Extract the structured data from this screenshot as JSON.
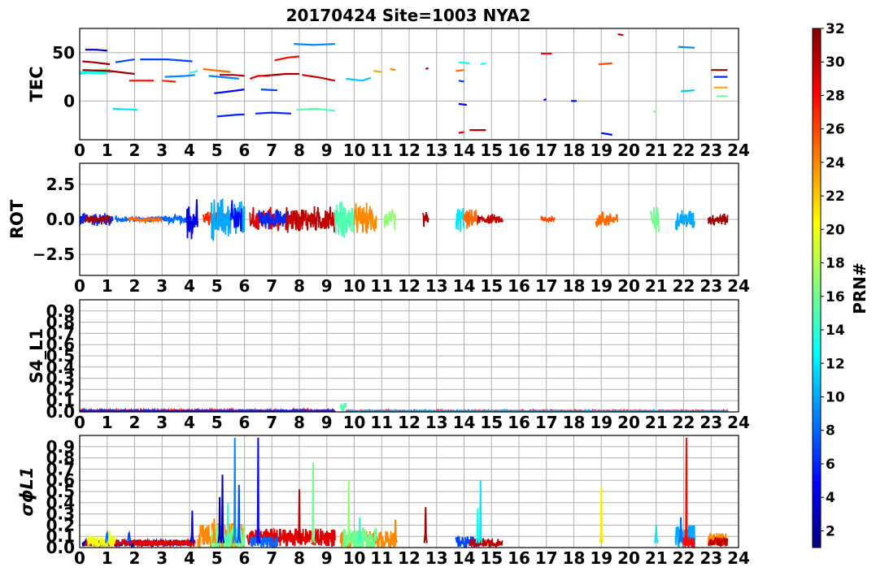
{
  "title": "20170424 Site=1003 NYA2",
  "colorbar": {
    "label": "PRN#",
    "ticks": [
      2,
      4,
      6,
      8,
      10,
      12,
      14,
      16,
      18,
      20,
      22,
      24,
      26,
      28,
      30,
      32
    ],
    "range": [
      1,
      32
    ],
    "colormap": "jet"
  },
  "x_ticks": [
    "0",
    "1",
    "2",
    "3",
    "4",
    "5",
    "6",
    "7",
    "8",
    "9",
    "10",
    "11",
    "12",
    "13",
    "14",
    "15",
    "16",
    "17",
    "18",
    "19",
    "20",
    "21",
    "22",
    "23",
    "24"
  ],
  "chart_data": [
    {
      "type": "line",
      "ylabel": "TEC",
      "xlim": [
        0,
        24
      ],
      "ylim": [
        -40,
        75
      ],
      "yticks": [
        {
          "v": 50,
          "t": "50"
        },
        {
          "v": 0,
          "t": "0"
        }
      ],
      "grid": true,
      "series": [
        {
          "prn": 3,
          "x": [
            0.2,
            0.6,
            1.0
          ],
          "y": [
            53,
            53,
            52
          ]
        },
        {
          "prn": 31,
          "x": [
            0.1,
            0.5,
            1.1
          ],
          "y": [
            41,
            40,
            38
          ]
        },
        {
          "prn": 17,
          "x": [
            0.1,
            0.6,
            1.0
          ],
          "y": [
            29,
            32,
            33
          ]
        },
        {
          "prn": 24,
          "x": [
            0.0,
            0.4,
            1.1
          ],
          "y": [
            28,
            30,
            32
          ]
        },
        {
          "prn": 13,
          "x": [
            0.0,
            0.5
          ],
          "y": [
            30,
            31
          ]
        },
        {
          "prn": 14,
          "x": [
            0.0,
            1.0
          ],
          "y": [
            29,
            28
          ]
        },
        {
          "prn": 13,
          "x": [
            0.0,
            1.2
          ],
          "y": [
            29,
            30
          ]
        },
        {
          "prn": 12,
          "x": [
            1.2,
            2.1
          ],
          "y": [
            -8,
            -9
          ]
        },
        {
          "prn": 7,
          "x": [
            1.3,
            2.0
          ],
          "y": [
            40,
            43
          ]
        },
        {
          "prn": 7,
          "x": [
            2.2,
            3.2,
            4.1
          ],
          "y": [
            43,
            43,
            41
          ]
        },
        {
          "prn": 28,
          "x": [
            1.8,
            2.7
          ],
          "y": [
            21,
            21
          ]
        },
        {
          "prn": 27,
          "x": [
            3.0,
            3.5
          ],
          "y": [
            21,
            20
          ]
        },
        {
          "prn": 31,
          "x": [
            0.1,
            1.1,
            2.0
          ],
          "y": [
            32,
            31,
            28
          ]
        },
        {
          "prn": 9,
          "x": [
            3.1,
            3.9,
            4.2
          ],
          "y": [
            25,
            26,
            27
          ]
        },
        {
          "prn": 14,
          "x": [
            4.0,
            4.3
          ],
          "y": [
            29,
            31
          ]
        },
        {
          "prn": 25,
          "x": [
            4.5,
            5.5
          ],
          "y": [
            33,
            30
          ]
        },
        {
          "prn": 5,
          "x": [
            4.9,
            5.5,
            6.0
          ],
          "y": [
            8,
            10,
            12
          ]
        },
        {
          "prn": 6,
          "x": [
            5.0,
            5.8,
            6.0
          ],
          "y": [
            -16,
            -14,
            -14
          ]
        },
        {
          "prn": 9,
          "x": [
            4.7,
            5.8
          ],
          "y": [
            26,
            23
          ]
        },
        {
          "prn": 30,
          "x": [
            5.1,
            5.6,
            6.0
          ],
          "y": [
            27,
            27,
            26
          ]
        },
        {
          "prn": 29,
          "x": [
            6.2,
            6.5,
            6.9
          ],
          "y": [
            23,
            26,
            26
          ]
        },
        {
          "prn": 7,
          "x": [
            6.6,
            7.2
          ],
          "y": [
            12,
            11
          ]
        },
        {
          "prn": 6,
          "x": [
            6.4,
            7.0,
            7.7
          ],
          "y": [
            -13,
            -12,
            -13
          ]
        },
        {
          "prn": 31,
          "x": [
            6.7,
            7.5,
            8.0
          ],
          "y": [
            26,
            28,
            28
          ]
        },
        {
          "prn": 28,
          "x": [
            7.1,
            7.6,
            8.0
          ],
          "y": [
            42,
            45,
            46
          ]
        },
        {
          "prn": 9,
          "x": [
            7.8,
            8.5,
            9.3
          ],
          "y": [
            59,
            58,
            59
          ]
        },
        {
          "prn": 15,
          "x": [
            7.9,
            8.6,
            9.3
          ],
          "y": [
            -9,
            -8,
            -10
          ]
        },
        {
          "prn": 30,
          "x": [
            8.1,
            8.8,
            9.3
          ],
          "y": [
            27,
            24,
            21
          ]
        },
        {
          "prn": 11,
          "x": [
            9.7,
            10.3,
            10.6
          ],
          "y": [
            23,
            21,
            24
          ]
        },
        {
          "prn": 23,
          "x": [
            10.7,
            11.0
          ],
          "y": [
            31,
            30
          ]
        },
        {
          "prn": 24,
          "x": [
            11.3,
            11.5
          ],
          "y": [
            33,
            32
          ]
        },
        {
          "prn": 31,
          "x": [
            12.6,
            12.7
          ],
          "y": [
            33,
            34
          ]
        },
        {
          "prn": 13,
          "x": [
            13.8,
            14.2
          ],
          "y": [
            40,
            39
          ]
        },
        {
          "prn": 13,
          "x": [
            14.6,
            14.8
          ],
          "y": [
            38,
            39
          ]
        },
        {
          "prn": 25,
          "x": [
            13.7,
            14.0
          ],
          "y": [
            31,
            32
          ]
        },
        {
          "prn": 7,
          "x": [
            13.8,
            14.0
          ],
          "y": [
            21,
            20
          ]
        },
        {
          "prn": 5,
          "x": [
            13.8,
            14.1
          ],
          "y": [
            -3,
            -4
          ]
        },
        {
          "prn": 29,
          "x": [
            13.8,
            14.0
          ],
          "y": [
            -33,
            -32
          ]
        },
        {
          "prn": 30,
          "x": [
            14.2,
            14.8
          ],
          "y": [
            -30,
            -30
          ]
        },
        {
          "prn": 28,
          "x": [
            16.8,
            17.2
          ],
          "y": [
            49,
            49
          ]
        },
        {
          "prn": 5,
          "x": [
            16.9,
            17.0
          ],
          "y": [
            1,
            2
          ]
        },
        {
          "prn": 5,
          "x": [
            17.9,
            18.1
          ],
          "y": [
            0,
            0
          ]
        },
        {
          "prn": 26,
          "x": [
            18.9,
            19.4
          ],
          "y": [
            38,
            39
          ]
        },
        {
          "prn": 5,
          "x": [
            19.0,
            19.4
          ],
          "y": [
            -33,
            -35
          ]
        },
        {
          "prn": 30,
          "x": [
            19.6,
            19.8
          ],
          "y": [
            69,
            68
          ]
        },
        {
          "prn": 16,
          "x": [
            20.9,
            21.0
          ],
          "y": [
            -10,
            -12
          ]
        },
        {
          "prn": 9,
          "x": [
            21.8,
            22.4
          ],
          "y": [
            56,
            55
          ]
        },
        {
          "prn": 11,
          "x": [
            21.9,
            22.4
          ],
          "y": [
            10,
            11
          ]
        },
        {
          "prn": 23,
          "x": [
            23.1,
            23.6
          ],
          "y": [
            14,
            14
          ]
        },
        {
          "prn": 31,
          "x": [
            23.0,
            23.6
          ],
          "y": [
            32,
            32
          ]
        },
        {
          "prn": 6,
          "x": [
            23.1,
            23.6
          ],
          "y": [
            25,
            25
          ]
        },
        {
          "prn": 16,
          "x": [
            23.2,
            23.6
          ],
          "y": [
            5,
            5
          ]
        }
      ]
    },
    {
      "type": "line",
      "ylabel": "ROT",
      "xlim": [
        0,
        24
      ],
      "ylim": [
        -4,
        4
      ],
      "yticks": [
        {
          "v": 2.5,
          "t": "2.5"
        },
        {
          "v": 0,
          "t": "0.0"
        },
        {
          "v": -2.5,
          "t": "−2.5"
        }
      ],
      "grid": true,
      "noise": [
        {
          "prn": 6,
          "x0": 0.0,
          "x1": 1.2,
          "amp": 0.6
        },
        {
          "prn": 31,
          "x0": 0.2,
          "x1": 1.1,
          "amp": 0.4
        },
        {
          "prn": 8,
          "x0": 1.3,
          "x1": 3.2,
          "amp": 0.25
        },
        {
          "prn": 25,
          "x0": 1.8,
          "x1": 3.0,
          "amp": 0.2
        },
        {
          "prn": 8,
          "x0": 3.1,
          "x1": 4.2,
          "amp": 0.35
        },
        {
          "prn": 4,
          "x0": 3.9,
          "x1": 4.3,
          "amp": 1.6
        },
        {
          "prn": 27,
          "x0": 4.5,
          "x1": 5.5,
          "amp": 0.7
        },
        {
          "prn": 10,
          "x0": 4.8,
          "x1": 6.0,
          "amp": 1.8
        },
        {
          "prn": 5,
          "x0": 5.5,
          "x1": 5.9,
          "amp": 1.6
        },
        {
          "prn": 29,
          "x0": 6.2,
          "x1": 7.3,
          "amp": 1.0
        },
        {
          "prn": 6,
          "x0": 6.5,
          "x1": 7.6,
          "amp": 0.8
        },
        {
          "prn": 30,
          "x0": 7.5,
          "x1": 9.3,
          "amp": 1.1
        },
        {
          "prn": 15,
          "x0": 9.3,
          "x1": 10.0,
          "amp": 1.6
        },
        {
          "prn": 24,
          "x0": 10.0,
          "x1": 10.8,
          "amp": 1.3
        },
        {
          "prn": 17,
          "x0": 11.1,
          "x1": 11.5,
          "amp": 0.9
        },
        {
          "prn": 31,
          "x0": 12.5,
          "x1": 12.7,
          "amp": 0.8
        },
        {
          "prn": 12,
          "x0": 13.7,
          "x1": 14.0,
          "amp": 1.1
        },
        {
          "prn": 25,
          "x0": 14.0,
          "x1": 14.5,
          "amp": 0.8
        },
        {
          "prn": 30,
          "x0": 14.5,
          "x1": 15.4,
          "amp": 0.4
        },
        {
          "prn": 26,
          "x0": 16.8,
          "x1": 17.3,
          "amp": 0.3
        },
        {
          "prn": 25,
          "x0": 18.8,
          "x1": 19.6,
          "amp": 0.7
        },
        {
          "prn": 16,
          "x0": 20.8,
          "x1": 21.1,
          "amp": 1.1
        },
        {
          "prn": 10,
          "x0": 21.7,
          "x1": 22.4,
          "amp": 0.9
        },
        {
          "prn": 31,
          "x0": 22.9,
          "x1": 23.6,
          "amp": 0.5
        }
      ]
    },
    {
      "type": "line",
      "ylabel": "S4_L1",
      "xlim": [
        0,
        24
      ],
      "ylim": [
        0,
        1
      ],
      "yticks": [
        {
          "v": 0.9,
          "t": "0.9"
        },
        {
          "v": 0.8,
          "t": "0.8"
        },
        {
          "v": 0.7,
          "t": "0.7"
        },
        {
          "v": 0.6,
          "t": "0.6"
        },
        {
          "v": 0.5,
          "t": "0.5"
        },
        {
          "v": 0.4,
          "t": "0.4"
        },
        {
          "v": 0.3,
          "t": "0.3"
        },
        {
          "v": 0.2,
          "t": "0.2"
        },
        {
          "v": 0.1,
          "t": "0.1"
        },
        {
          "v": 0.0,
          "t": "0.0"
        }
      ],
      "grid": true,
      "noise": [
        {
          "prn": 28,
          "x0": 0.0,
          "x1": 9.3,
          "amp": 0.008,
          "base": 0.01
        },
        {
          "prn": 6,
          "x0": 0.0,
          "x1": 9.3,
          "amp": 0.006,
          "base": 0.008
        },
        {
          "prn": 15,
          "x0": 9.5,
          "x1": 9.7,
          "amp": 0.04,
          "base": 0.04
        },
        {
          "prn": 28,
          "x0": 9.7,
          "x1": 23.6,
          "amp": 0.005,
          "base": 0.008
        },
        {
          "prn": 10,
          "x0": 9.7,
          "x1": 23.6,
          "amp": 0.005,
          "base": 0.006
        }
      ]
    },
    {
      "type": "line",
      "ylabel": "σϕL1",
      "xlim": [
        0,
        24
      ],
      "ylim": [
        0,
        1
      ],
      "yticks": [
        {
          "v": 0.9,
          "t": "0.9"
        },
        {
          "v": 0.8,
          "t": "0.8"
        },
        {
          "v": 0.7,
          "t": "0.7"
        },
        {
          "v": 0.6,
          "t": "0.6"
        },
        {
          "v": 0.5,
          "t": "0.5"
        },
        {
          "v": 0.4,
          "t": "0.4"
        },
        {
          "v": 0.3,
          "t": "0.3"
        },
        {
          "v": 0.2,
          "t": "0.2"
        },
        {
          "v": 0.1,
          "t": "0.1"
        },
        {
          "v": 0.0,
          "t": "0.0"
        }
      ],
      "grid": true,
      "noise": [
        {
          "prn": 2,
          "x0": 0.1,
          "x1": 4.2,
          "amp": 0.03,
          "base": 0.04
        },
        {
          "prn": 29,
          "x0": 0.2,
          "x1": 4.2,
          "amp": 0.03,
          "base": 0.04
        },
        {
          "prn": 20,
          "x0": 0.3,
          "x1": 1.3,
          "amp": 0.06,
          "base": 0.05
        },
        {
          "prn": 24,
          "x0": 4.3,
          "x1": 6.0,
          "amp": 0.12,
          "base": 0.1
        },
        {
          "prn": 16,
          "x0": 4.8,
          "x1": 6.0,
          "amp": 0.12,
          "base": 0.09
        },
        {
          "prn": 29,
          "x0": 6.1,
          "x1": 9.3,
          "amp": 0.08,
          "base": 0.09
        },
        {
          "prn": 8,
          "x0": 6.2,
          "x1": 7.2,
          "amp": 0.05,
          "base": 0.05
        },
        {
          "prn": 24,
          "x0": 9.5,
          "x1": 11.5,
          "amp": 0.08,
          "base": 0.07
        },
        {
          "prn": 16,
          "x0": 9.6,
          "x1": 10.8,
          "amp": 0.1,
          "base": 0.08
        },
        {
          "prn": 7,
          "x0": 13.7,
          "x1": 14.5,
          "amp": 0.05,
          "base": 0.05
        },
        {
          "prn": 30,
          "x0": 14.2,
          "x1": 15.4,
          "amp": 0.04,
          "base": 0.04
        },
        {
          "prn": 10,
          "x0": 21.7,
          "x1": 22.4,
          "amp": 0.1,
          "base": 0.1
        },
        {
          "prn": 28,
          "x0": 22.0,
          "x1": 22.4,
          "amp": 0.05,
          "base": 0.05
        },
        {
          "prn": 24,
          "x0": 22.9,
          "x1": 23.6,
          "amp": 0.06,
          "base": 0.07
        },
        {
          "prn": 30,
          "x0": 22.9,
          "x1": 23.6,
          "amp": 0.04,
          "base": 0.05
        }
      ],
      "spikes": [
        {
          "prn": 8,
          "x": 1.0,
          "y": 0.13
        },
        {
          "prn": 20,
          "x": 1.1,
          "y": 0.15
        },
        {
          "prn": 7,
          "x": 1.8,
          "y": 0.13
        },
        {
          "prn": 4,
          "x": 4.1,
          "y": 0.33
        },
        {
          "prn": 24,
          "x": 4.9,
          "y": 0.26
        },
        {
          "prn": 3,
          "x": 5.2,
          "y": 0.65
        },
        {
          "prn": 2,
          "x": 5.1,
          "y": 0.45
        },
        {
          "prn": 14,
          "x": 5.4,
          "y": 0.4
        },
        {
          "prn": 9,
          "x": 5.65,
          "y": 0.98
        },
        {
          "prn": 7,
          "x": 5.8,
          "y": 0.56
        },
        {
          "prn": 5,
          "x": 6.5,
          "y": 0.98
        },
        {
          "prn": 16,
          "x": 8.5,
          "y": 0.76
        },
        {
          "prn": 30,
          "x": 8.0,
          "y": 0.52
        },
        {
          "prn": 17,
          "x": 9.8,
          "y": 0.6
        },
        {
          "prn": 14,
          "x": 10.2,
          "y": 0.27
        },
        {
          "prn": 24,
          "x": 11.5,
          "y": 0.25
        },
        {
          "prn": 31,
          "x": 12.6,
          "y": 0.36
        },
        {
          "prn": 12,
          "x": 14.6,
          "y": 0.6
        },
        {
          "prn": 13,
          "x": 14.5,
          "y": 0.35
        },
        {
          "prn": 21,
          "x": 19.0,
          "y": 0.54
        },
        {
          "prn": 12,
          "x": 21.0,
          "y": 0.2
        },
        {
          "prn": 8,
          "x": 21.9,
          "y": 0.27
        },
        {
          "prn": 28,
          "x": 22.1,
          "y": 0.98
        }
      ]
    }
  ]
}
